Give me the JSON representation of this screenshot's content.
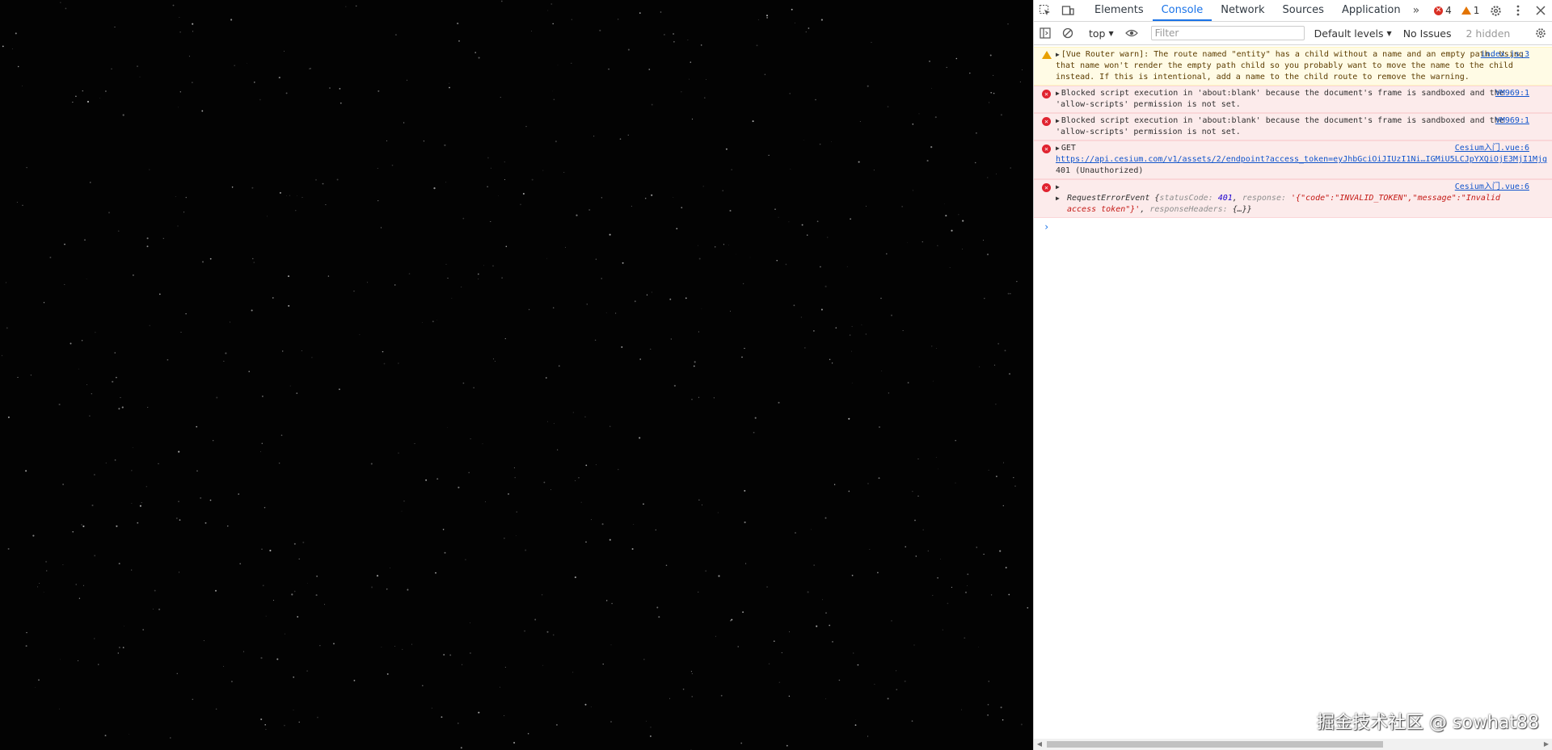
{
  "devtools": {
    "tabs": [
      "Elements",
      "Console",
      "Network",
      "Sources",
      "Application"
    ],
    "active_tab": "Console",
    "more_symbol": "»",
    "error_count": "4",
    "warning_count": "1",
    "toolbar": {
      "context": "top",
      "filter_placeholder": "Filter",
      "levels": "Default levels",
      "issues": "No Issues",
      "hidden": "2 hidden"
    },
    "messages": [
      {
        "level": "warn",
        "text": "[Vue Router warn]: The route named \"entity\" has a child without a name and an empty path. Using that name won't render the empty path child so you probably want to move the name to the child instead. If this is intentional, add a name to the child route to remove the warning.",
        "source": "index.js:3"
      },
      {
        "level": "error",
        "text": "Blocked script execution in 'about:blank' because the document's frame is sandboxed and the 'allow-scripts' permission is not set.",
        "source": "VM969:1"
      },
      {
        "level": "error",
        "text": "Blocked script execution in 'about:blank' because the document's frame is sandboxed and the 'allow-scripts' permission is not set.",
        "source": "VM969:1"
      },
      {
        "level": "error",
        "method": "GET",
        "url": "https://api.cesium.com/v1/assets/2/endpoint?access_token=eyJhbGciOiJIUzI1Ni…IGMiU5LCJpYXQiOjE3MjI1Mjg",
        "status": "401 (Unauthorized)",
        "source": "Cesium入门.vue:6"
      },
      {
        "level": "error",
        "object_name": "RequestErrorEvent",
        "k1": "statusCode:",
        "v1": "401",
        "k2": "response:",
        "v2": "'{\"code\":\"INVALID_TOKEN\",\"message\":\"Invalid access token\"}'",
        "k3": "responseHeaders:",
        "v3": "{…}}",
        "source": "Cesium入门.vue:6"
      }
    ]
  },
  "watermark": "掘金技术社区 @ sowhat88"
}
